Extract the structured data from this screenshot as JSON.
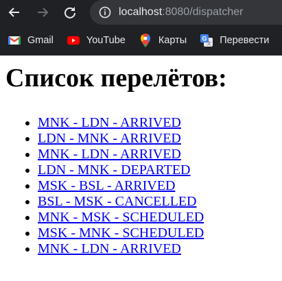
{
  "browser": {
    "url_host": "localhost",
    "url_rest": ":8080/dispatcher"
  },
  "bookmarks": [
    {
      "label": "Gmail",
      "icon": "gmail-icon"
    },
    {
      "label": "YouTube",
      "icon": "youtube-icon"
    },
    {
      "label": "Карты",
      "icon": "maps-icon"
    },
    {
      "label": "Перевести",
      "icon": "translate-icon"
    }
  ],
  "page": {
    "title": "Список перелётов:",
    "flights": [
      "MNK - LDN - ARRIVED",
      "LDN - MNK - ARRIVED",
      "MNK - LDN - ARRIVED",
      "LDN - MNK - DEPARTED",
      "MSK - BSL - ARRIVED",
      "BSL - MSK - CANCELLED",
      "MNK - MSK - SCHEDULED",
      "MSK - MNK - SCHEDULED",
      "MNK - LDN - ARRIVED"
    ]
  },
  "colors": {
    "toolbar_bg": "#202124",
    "omnibox_bg": "#35363a",
    "link": "#0000ee"
  }
}
